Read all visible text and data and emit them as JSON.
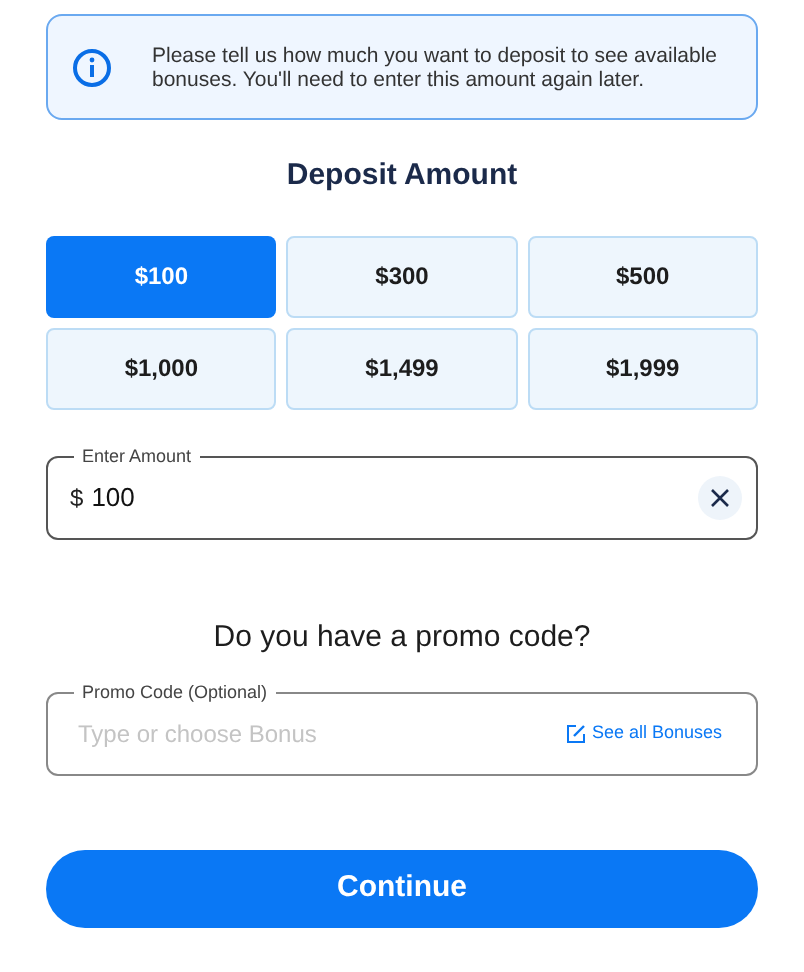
{
  "notice": {
    "text": "Please tell us how much you want to deposit to see available bonuses. You'll need to enter this amount again later."
  },
  "deposit": {
    "title": "Deposit Amount",
    "amounts": [
      {
        "label": "$100",
        "selected": true
      },
      {
        "label": "$300",
        "selected": false
      },
      {
        "label": "$500",
        "selected": false
      },
      {
        "label": "$1,000",
        "selected": false
      },
      {
        "label": "$1,499",
        "selected": false
      },
      {
        "label": "$1,999",
        "selected": false
      }
    ]
  },
  "amount_field": {
    "label": "Enter Amount",
    "currency": "$",
    "value": "100"
  },
  "promo": {
    "title": "Do you have a promo code?",
    "label": "Promo Code (Optional)",
    "placeholder": "Type or choose Bonus",
    "link": "See all Bonuses"
  },
  "continue_button": "Continue"
}
